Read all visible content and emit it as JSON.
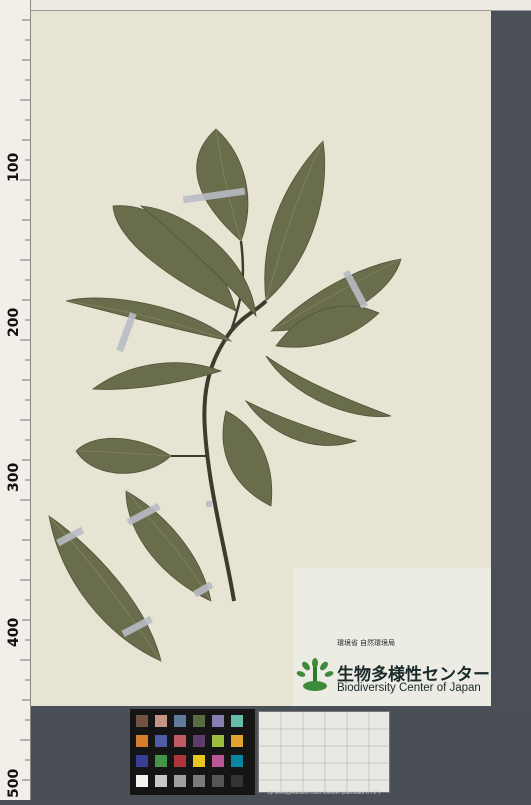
{
  "label": {
    "ministry": "環境省 自然環境局",
    "title_jp": "生物多様性センター",
    "title_en": "Biodiversity Center of Japan"
  },
  "ruler": {
    "numbers": [
      "100",
      "200",
      "300",
      "400",
      "500"
    ]
  },
  "card_caption": "by GretagMacbeth color checker (illuminant C / 2°)",
  "colors": {
    "sheet": "#e8e4d4",
    "leaf": "#6d7050",
    "leaf_dark": "#545638",
    "stem": "#3d3a30",
    "tape": "#b8bcc4",
    "background": "#4b4f57"
  }
}
